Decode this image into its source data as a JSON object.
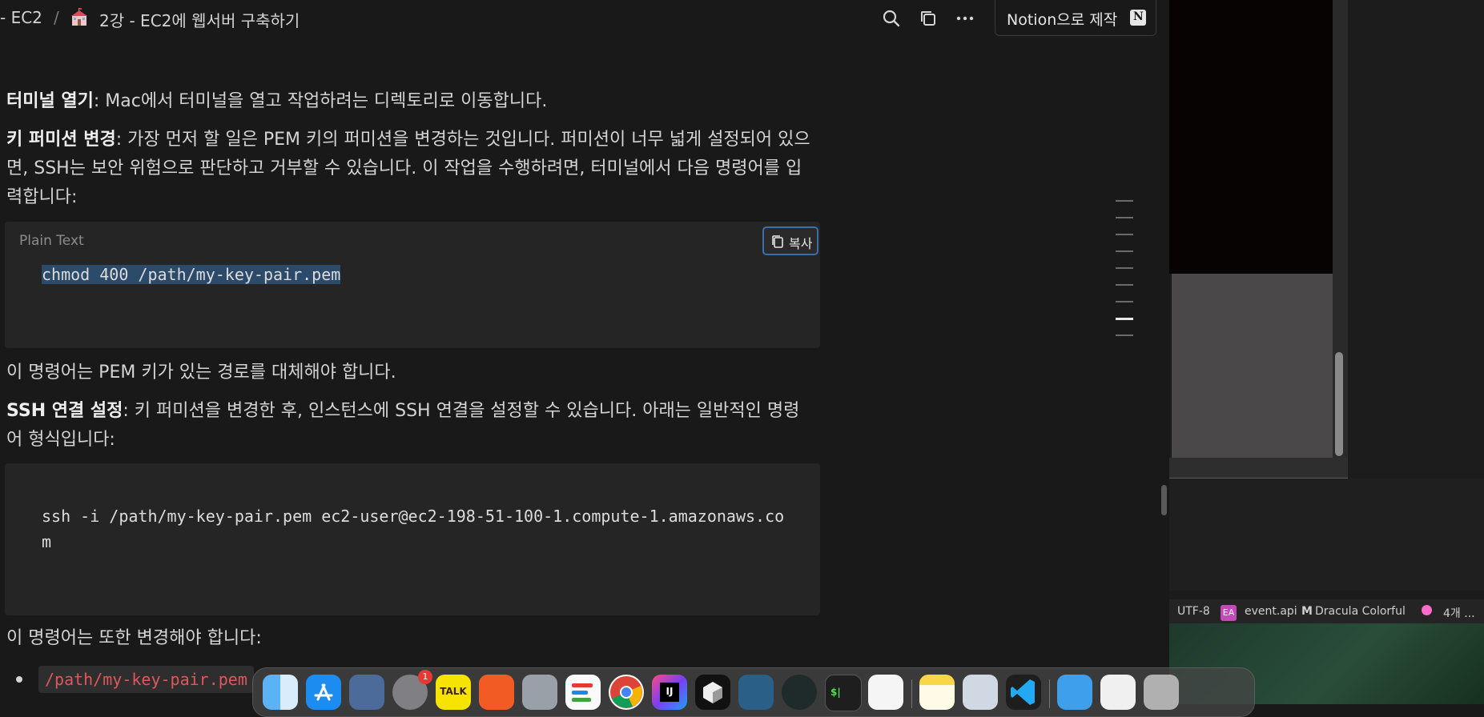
{
  "breadcrumb": {
    "parent": "- EC2",
    "separator": "/",
    "page_title": "2강 - EC2에 웹서버 구축하기"
  },
  "topbar": {
    "made_with_label": "Notion으로 제작",
    "notion_logo": "N"
  },
  "content": {
    "p1_bold": "터미널 열기",
    "p1_text": ": Mac에서 터미널을 열고 작업하려는 디렉토리로 이동합니다.",
    "p2_bold": "키 퍼미션 변경",
    "p2_line1": ": 가장 먼저 할 일은 PEM 키의 퍼미션을 변경하는 것입니다. 퍼미션이 너무 넓게 설정되어 있으",
    "p2_line2": "면, SSH는 보안 위험으로 판단하고 거부할 수 있습니다. 이 작업을 수행하려면, 터미널에서 다음 명령어를 입",
    "p2_line3": "력합니다:",
    "code1_language": "Plain Text",
    "code1_copy_label": "복사",
    "code1_text": "chmod 400 /path/my-key-pair.pem",
    "p3_text": "이 명령어는 PEM 키가 있는 경로를 대체해야 합니다.",
    "p4_bold": "SSH 연결 설정",
    "p4_line1": ": 키 퍼미션을 변경한 후, 인스턴스에 SSH 연결을 설정할 수 있습니다. 아래는 일반적인 명령",
    "p4_line2": "어 형식입니다:",
    "code2_line1": "ssh -i /path/my-key-pair.pem ec2-user@ec2-198-51-100-1.compute-1.amazonaws.co",
    "code2_line2": "m",
    "p5_text": "이 명령어는 또한 변경해야 합니다:",
    "bullet1_code": "/path/my-key-pair.pem"
  },
  "statusbar": {
    "encoding": "UTF-8",
    "file_badge": "EA",
    "file_name": "event.api",
    "theme_badge": "M",
    "theme_name": "Dracula Colorful",
    "more": "4개 ..."
  },
  "dock": {
    "settings_badge": "1",
    "kakaotalk_label": "TALK",
    "intellij_label": "IJ",
    "terminal_label": "$|",
    "apps": [
      "finder-icon",
      "app-store-icon",
      "simulator-icon",
      "system-settings-icon",
      "kakaotalk-icon",
      "sketchbook-icon",
      "launchpad-icon",
      "reminders-icon",
      "chrome-icon",
      "intellij-icon",
      "3d-app-icon",
      "mysql-workbench-icon",
      "gitkraken-icon",
      "terminal-icon",
      "textedit-icon",
      "notes-icon",
      "preview-icon",
      "vscode-icon",
      "folder-icon",
      "certificate-icon",
      "trash-icon"
    ]
  },
  "colors": {
    "background": "#191919",
    "code_bg": "#252525",
    "selection": "#2c4a69",
    "inline_code": "#e0575b"
  }
}
